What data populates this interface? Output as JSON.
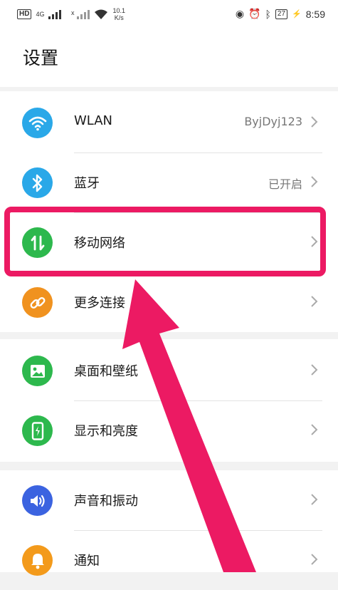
{
  "status_bar": {
    "hd": "HD",
    "network": "4G",
    "speed_value": "10.1",
    "speed_unit": "K/s",
    "battery": "27",
    "time": "8:59"
  },
  "header": {
    "title": "设置"
  },
  "settings": [
    {
      "label": "WLAN",
      "value": "ByjDyj123",
      "icon": "wifi-icon",
      "color": "#2aa8e8"
    },
    {
      "label": "蓝牙",
      "value": "已开启",
      "icon": "bluetooth-icon",
      "color": "#2aa8e8"
    },
    {
      "label": "移动网络",
      "value": "",
      "icon": "mobile-data-icon",
      "color": "#2db84d"
    },
    {
      "label": "更多连接",
      "value": "",
      "icon": "link-icon",
      "color": "#f0921f"
    },
    {
      "label": "桌面和壁纸",
      "value": "",
      "icon": "wallpaper-icon",
      "color": "#2db84d"
    },
    {
      "label": "显示和亮度",
      "value": "",
      "icon": "display-icon",
      "color": "#2db84d"
    },
    {
      "label": "声音和振动",
      "value": "",
      "icon": "sound-icon",
      "color": "#3b63e0"
    },
    {
      "label": "通知",
      "value": "",
      "icon": "bell-icon",
      "color": "#f39a1b"
    }
  ],
  "annotation": {
    "highlight_color": "#ec1a63"
  }
}
